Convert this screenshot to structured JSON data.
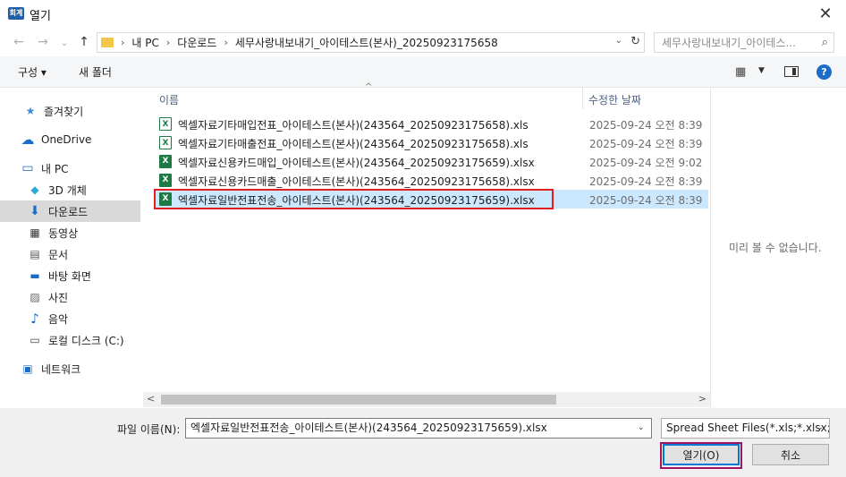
{
  "window": {
    "title": "열기",
    "app_icon_text": "회계",
    "close_glyph": "✕"
  },
  "navigation": {
    "back": "←",
    "forward": "→",
    "recent": "⌄",
    "up": "↑"
  },
  "address": {
    "crumbs": [
      "내 PC",
      "다운로드",
      "세무사랑내보내기_아이테스트(본사)_20250923175658"
    ],
    "separator": "›",
    "dropdown": "⌄",
    "refresh": "↻"
  },
  "search": {
    "placeholder": "세무사랑내보내기_아이테스...",
    "icon": "⌕"
  },
  "toolbar": {
    "organize": "구성 ▾",
    "new_folder": "새 폴더",
    "view_icon": "▦",
    "view_drop": "▼",
    "help": "?"
  },
  "sidebar": {
    "items": [
      {
        "label": "즐겨찾기",
        "icon": "★",
        "icon_name": "star-icon"
      },
      {
        "label": "OneDrive",
        "icon": "☁",
        "icon_name": "cloud-icon"
      },
      {
        "label": "내 PC",
        "icon": "▭",
        "icon_name": "computer-icon"
      },
      {
        "label": "3D 개체",
        "icon": "◆",
        "icon_name": "cube-icon"
      },
      {
        "label": "다운로드",
        "icon": "⬇",
        "icon_name": "download-icon"
      },
      {
        "label": "동영상",
        "icon": "▦",
        "icon_name": "video-icon"
      },
      {
        "label": "문서",
        "icon": "▤",
        "icon_name": "document-icon"
      },
      {
        "label": "바탕 화면",
        "icon": "▬",
        "icon_name": "desktop-icon"
      },
      {
        "label": "사진",
        "icon": "▨",
        "icon_name": "picture-icon"
      },
      {
        "label": "음악",
        "icon": "♪",
        "icon_name": "music-icon"
      },
      {
        "label": "로컬 디스크 (C:)",
        "icon": "▭",
        "icon_name": "disk-icon"
      },
      {
        "label": "네트워크",
        "icon": "▣",
        "icon_name": "network-icon"
      }
    ],
    "selected": "다운로드"
  },
  "file_list": {
    "columns": {
      "name": "이름",
      "date": "수정한 날짜"
    },
    "sort_arrow": "^",
    "files": [
      {
        "name": "엑셀자료기타매입전표_아이테스트(본사)(243564_20250923175658).xls",
        "date": "2025-09-24 오전 8:39",
        "icon_text": "X",
        "type": "xls"
      },
      {
        "name": "엑셀자료기타매출전표_아이테스트(본사)(243564_20250923175658).xls",
        "date": "2025-09-24 오전 8:39",
        "icon_text": "X",
        "type": "xls"
      },
      {
        "name": "엑셀자료신용카드매입_아이테스트(본사)(243564_20250923175659).xlsx",
        "date": "2025-09-24 오전 9:02",
        "icon_text": "X",
        "type": "xlsx"
      },
      {
        "name": "엑셀자료신용카드매출_아이테스트(본사)(243564_20250923175658).xlsx",
        "date": "2025-09-24 오전 8:39",
        "icon_text": "X",
        "type": "xlsx"
      },
      {
        "name": "엑셀자료일반전표전송_아이테스트(본사)(243564_20250923175659).xlsx",
        "date": "2025-09-24 오전 8:39",
        "icon_text": "X",
        "type": "xlsx"
      }
    ],
    "selected_index": 4
  },
  "scrollbar": {
    "left": "<",
    "right": ">"
  },
  "preview": {
    "message": "미리 볼 수 없습니다."
  },
  "footer": {
    "filename_label": "파일 이름(N):",
    "filename_value": "엑셀자료일반전표전송_아이테스트(본사)(243564_20250923175659).xlsx",
    "filter_value": "Spread Sheet Files(*.xls;*.xlsx;*",
    "dropdown": "⌄",
    "open_label": "열기(O)",
    "cancel_label": "취소"
  }
}
